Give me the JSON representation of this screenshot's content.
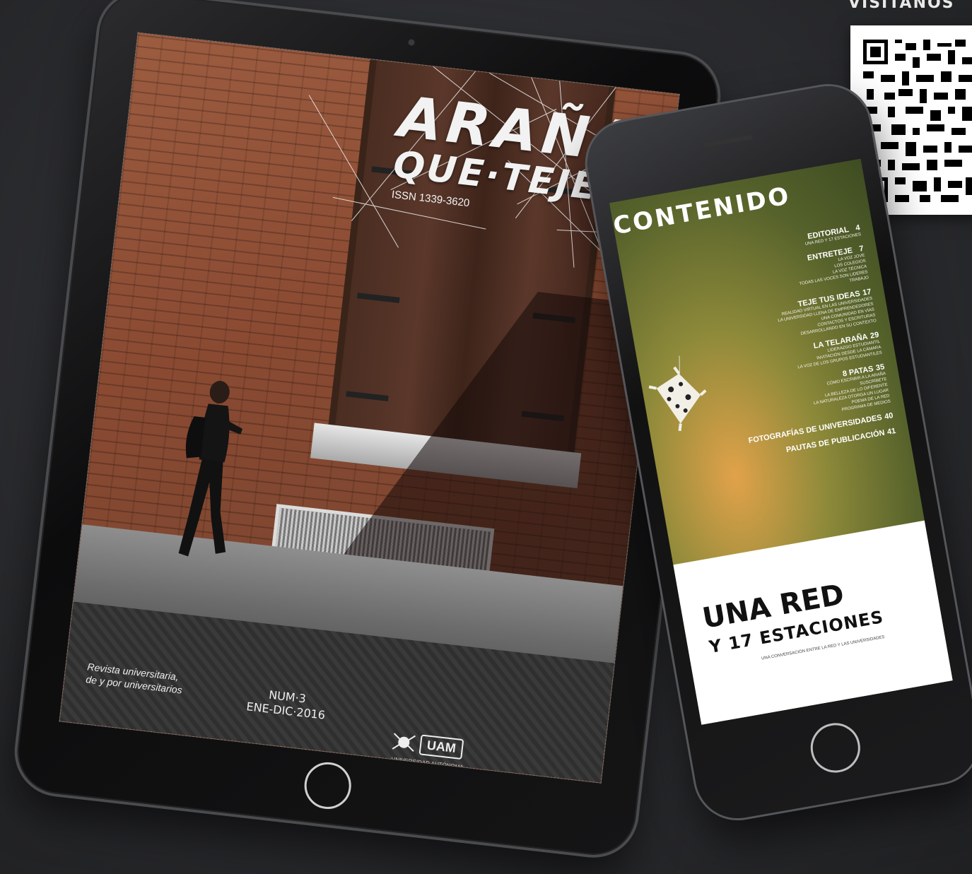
{
  "top_label": "VISITANOS",
  "tablet": {
    "title_line1": "ARAÑA",
    "title_line2": "QUE·TEJE",
    "issn": "ISSN 1339-3620",
    "tagline_line1": "Revista universitaria,",
    "tagline_line2": "de y por universitarios",
    "issue_number": "NUM·3",
    "issue_dates": "ENE-DIC·2016",
    "publisher_badge": "UAM",
    "publisher_sub": "UNIVERSIDAD AUTÓNOMA DE MANIZALES"
  },
  "phone": {
    "contents_title": "CONTENIDO",
    "sections": [
      {
        "title": "EDITORIAL",
        "page": "4",
        "items": [
          "UNA RED Y 17 ESTACIONES"
        ]
      },
      {
        "title": "ENTRETEJE",
        "page": "7",
        "items": [
          "LA VOZ JOVE",
          "LOS COLEGIOS",
          "LA VOZ TÉCNICA",
          "TODAS LAS VOCES SON LIDERES",
          "TRABAJO"
        ]
      },
      {
        "title": "TEJE TUS IDEAS",
        "page": "17",
        "items": [
          "REALIDAD VIRTUAL EN LAS UNIVERSIDADES",
          "LA UNIVERSIDAD LLENA DE EMPRENDEDORES",
          "UNA COMUNIDAD EN VÍAS",
          "CONTACTOS Y ESCRITURAS",
          "DESARROLLANDO EN SU CONTEXTO"
        ]
      },
      {
        "title": "LA TELARAÑA",
        "page": "29",
        "items": [
          "LIDERAZGO ESTUDIANTIL",
          "INVITACIÓN DESDE LA CÁMARA",
          "LA VOZ DE LOS GRUPOS ESTUDIANTILES"
        ]
      },
      {
        "title": "8 PATAS",
        "page": "35",
        "items": [
          "CÓMO ESCRIBIR A LA ARAÑA",
          "SUSCRÍBETE",
          "LA BELLEZA DE LO DIFERENTE",
          "LA NATURALEZA OTORGA UN LUGAR",
          "POEMA DE LA RED",
          "PROGRAMA DE MEDIOS"
        ]
      },
      {
        "title": "FOTOGRAFÍAS DE UNIVERSIDADES",
        "page": "40",
        "items": []
      },
      {
        "title": "PAUTAS DE PUBLICACIÓN",
        "page": "41",
        "items": []
      }
    ],
    "headline_line1": "UNA RED",
    "headline_line2": "Y 17 ESTACIONES",
    "fine_print": "UNA CONVERSACIÓN ENTRE LA RED Y LAS UNIVERSIDADES"
  }
}
